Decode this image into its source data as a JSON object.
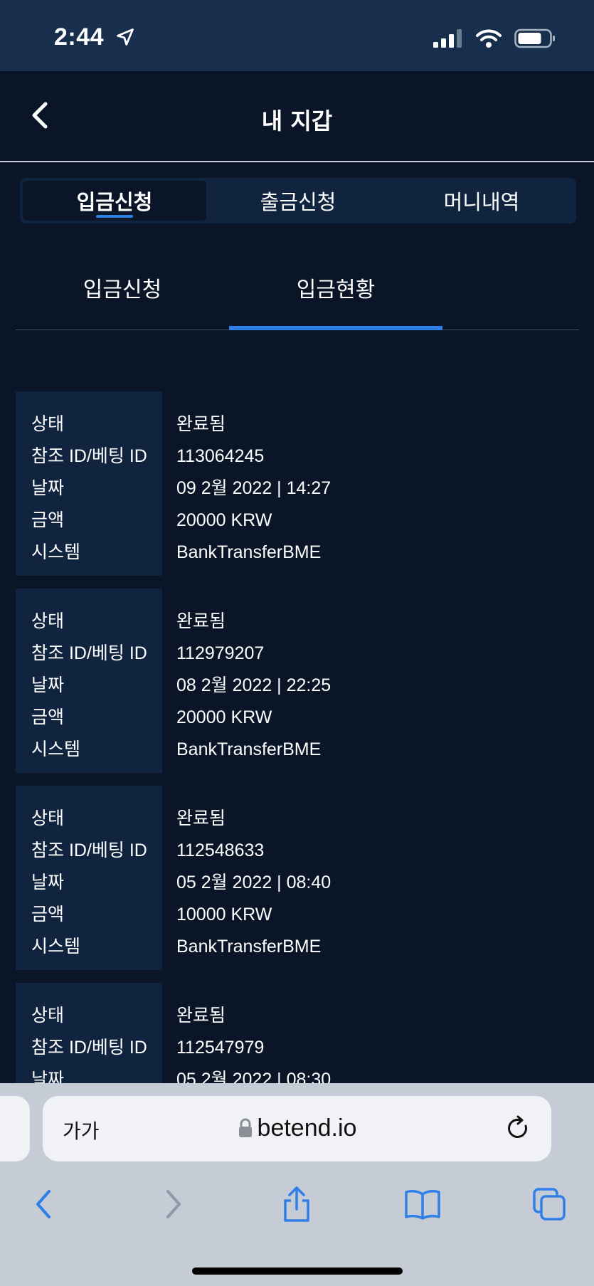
{
  "status_bar": {
    "time": "2:44"
  },
  "header": {
    "title": "내 지갑"
  },
  "main_tabs": [
    {
      "label": "입금신청",
      "active": true
    },
    {
      "label": "출금신청",
      "active": false
    },
    {
      "label": "머니내역",
      "active": false
    }
  ],
  "sub_tabs": [
    {
      "label": "입금신청",
      "active": false
    },
    {
      "label": "입금현황",
      "active": true
    }
  ],
  "record_labels": {
    "status": "상태",
    "reference": "참조 ID/베팅 ID",
    "date": "날짜",
    "amount": "금액",
    "system": "시스템"
  },
  "records": [
    {
      "status": "완료됨",
      "reference": "113064245",
      "date": "09 2월 2022 | 14:27",
      "amount": "20000 KRW",
      "system": "BankTransferBME"
    },
    {
      "status": "완료됨",
      "reference": "112979207",
      "date": "08 2월 2022 | 22:25",
      "amount": "20000 KRW",
      "system": "BankTransferBME"
    },
    {
      "status": "완료됨",
      "reference": "112548633",
      "date": "05 2월 2022 | 08:40",
      "amount": "10000 KRW",
      "system": "BankTransferBME"
    },
    {
      "status": "완료됨",
      "reference": "112547979",
      "date": "05 2월 2022 | 08:30"
    }
  ],
  "browser": {
    "text_size_label": "가가",
    "url": "betend.io"
  },
  "colors": {
    "background": "#0a1628",
    "panel": "#11243f",
    "accent": "#2f7fe8",
    "browser_bar": "#c5ccd5",
    "browser_icon": "#2f7fe8"
  },
  "icons": {
    "back": "chevron-left-icon",
    "location": "location-arrow-icon",
    "signal": "cellular-signal-icon",
    "wifi": "wifi-icon",
    "battery": "battery-icon",
    "lock": "lock-icon",
    "reload": "reload-icon",
    "browser_back": "chevron-left-icon",
    "browser_forward": "chevron-right-icon",
    "share": "share-icon",
    "bookmarks": "book-icon",
    "tabs": "tabs-icon"
  }
}
